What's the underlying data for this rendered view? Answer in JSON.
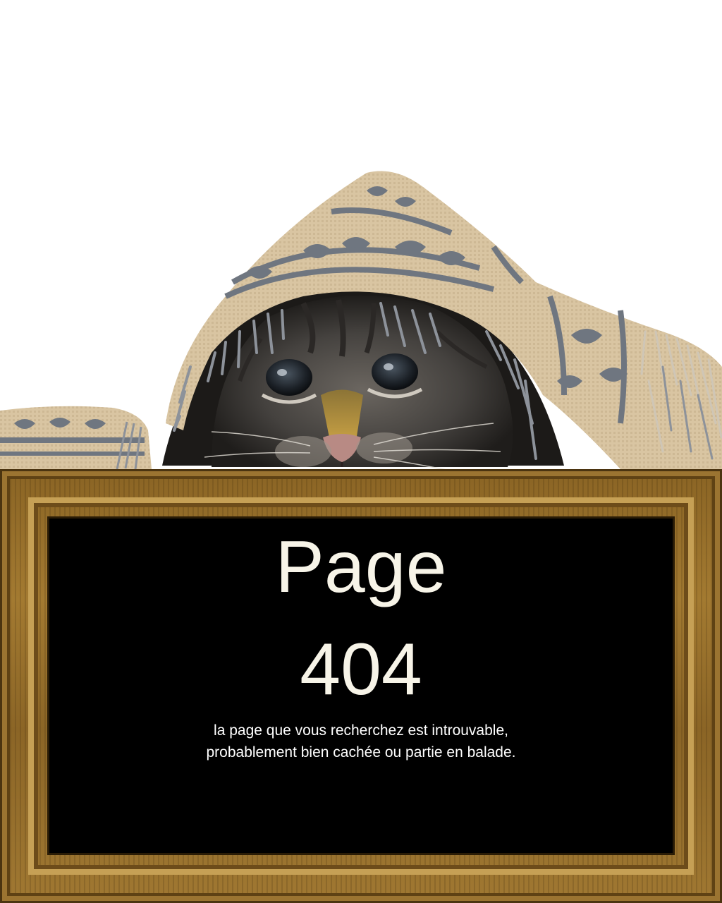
{
  "board": {
    "title_line1": "Page",
    "title_line2": "404",
    "message_line1": "la page que vous recherchez est introuvable,",
    "message_line2": "probablement bien cachée ou partie en balade."
  },
  "illustration": {
    "subject": "kitten-under-scarf",
    "colors": {
      "scarf_base": "#d8c3a0",
      "scarf_pattern": "#6f7680",
      "fur": "#4d4a46",
      "frame_wood": "#8f6a2a",
      "board": "#000000",
      "text": "#f7f4e8"
    }
  }
}
